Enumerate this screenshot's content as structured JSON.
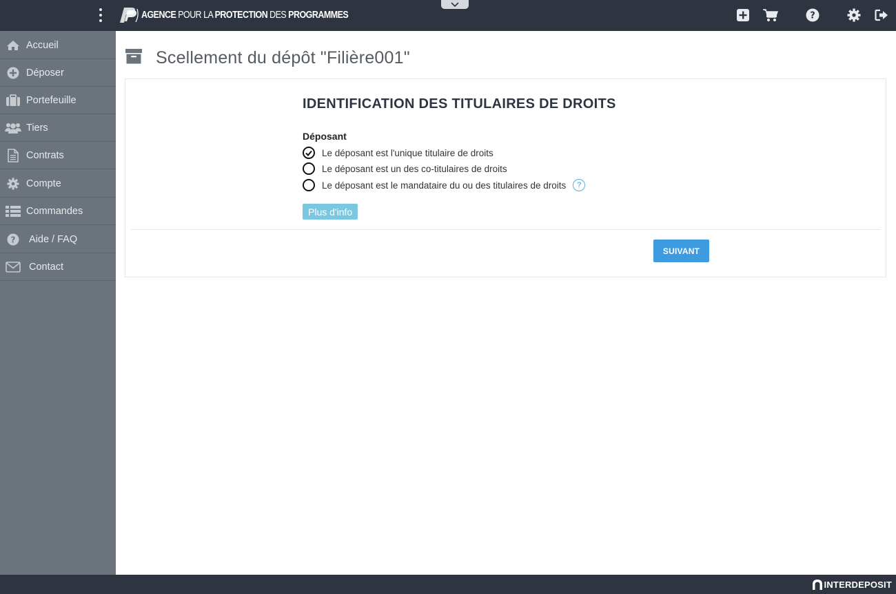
{
  "header": {
    "brand_1": "AGENCE",
    "brand_2": " POUR LA ",
    "brand_3": "PROTECTION",
    "brand_4": " DES ",
    "brand_5": "PROGRAMMES",
    "icons": [
      "plus-square-icon",
      "cart-icon",
      "help-circle-icon",
      "gear-icon",
      "logout-icon"
    ]
  },
  "sidebar": {
    "items": [
      {
        "label": "Accueil",
        "icon": "home-icon"
      },
      {
        "label": "Déposer",
        "icon": "plus-circle-icon"
      },
      {
        "label": "Portefeuille",
        "icon": "briefcase-icon"
      },
      {
        "label": "Tiers",
        "icon": "users-icon"
      },
      {
        "label": "Contrats",
        "icon": "document-icon"
      },
      {
        "label": "Compte",
        "icon": "gear-icon"
      },
      {
        "label": "Commandes",
        "icon": "list-icon"
      },
      {
        "label": "Aide / FAQ",
        "icon": "question-circle-icon"
      },
      {
        "label": "Contact",
        "icon": "envelope-icon"
      }
    ]
  },
  "page": {
    "title": "Scellement du dépôt \"Filière001\"",
    "title_icon": "archive-icon"
  },
  "form": {
    "section_title": "IDENTIFICATION DES TITULAIRES DE DROITS",
    "group_label": "Déposant",
    "options": [
      {
        "label": "Le déposant est l'unique titulaire de droits",
        "selected": true
      },
      {
        "label": "Le déposant est un des co-titulaires de droits",
        "selected": false
      },
      {
        "label": "Le déposant est le mandataire du ou des titulaires de droits",
        "selected": false
      }
    ],
    "help_glyph": "?",
    "more_info_label": "Plus d'info",
    "next_label": "SUIVANT"
  },
  "footer": {
    "brand": "INTERDEPOSIT"
  },
  "colors": {
    "topbar": "#2e3540",
    "sidebar": "#6b737d",
    "primary_button": "#3d9be0",
    "info_button": "#7bc7e2"
  }
}
